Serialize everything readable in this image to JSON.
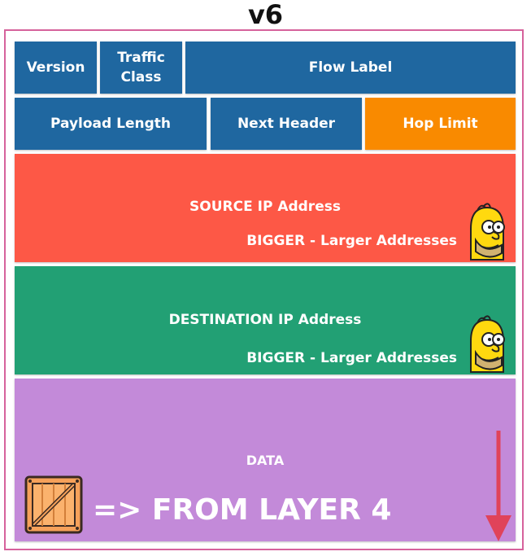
{
  "title": "v6",
  "header_rows": {
    "row1": {
      "version": "Version",
      "traffic_class": "Traffic Class",
      "flow_label": "Flow Label"
    },
    "row2": {
      "payload_length": "Payload Length",
      "next_header": "Next Header",
      "hop_limit": "Hop Limit"
    }
  },
  "source": {
    "label": "SOURCE IP Address",
    "note": "BIGGER - Larger Addresses"
  },
  "destination": {
    "label": "DESTINATION IP Address",
    "note": "BIGGER - Larger Addresses"
  },
  "data": {
    "label": "DATA",
    "from_layer": "=> FROM LAYER 4"
  },
  "icons": [
    "homer-icon",
    "crate-icon",
    "down-arrow-icon"
  ],
  "colors": {
    "frame": "#d6629c",
    "header_blue": "#1f67a0",
    "hop_limit": "#f98a00",
    "source": "#fd5846",
    "destination": "#22a074",
    "data": "#c38ad9",
    "arrow": "#e0435a"
  }
}
